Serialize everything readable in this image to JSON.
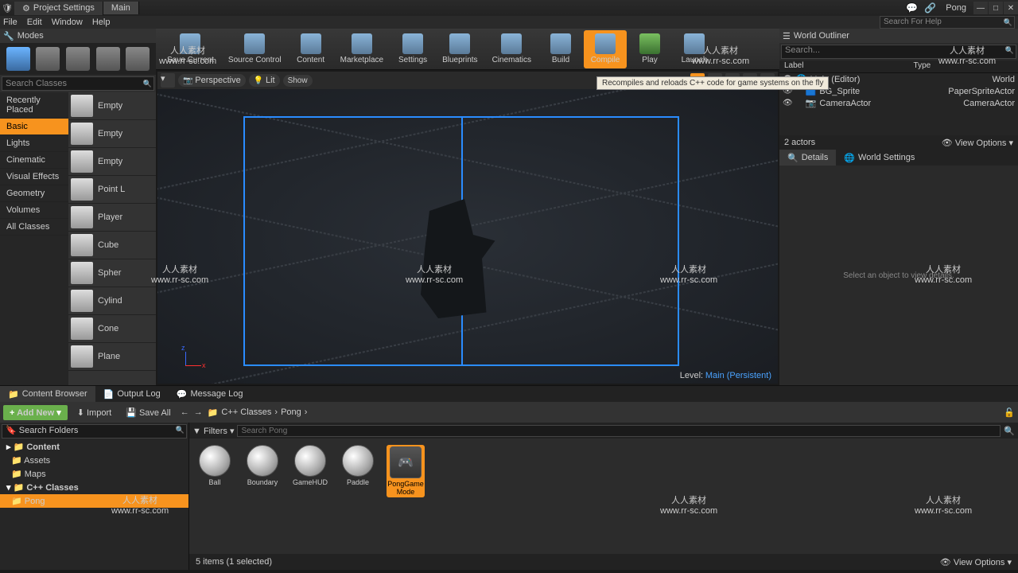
{
  "title": {
    "tab1": "Project Settings",
    "tab2": "Main",
    "project": "Pong"
  },
  "menu": [
    "File",
    "Edit",
    "Window",
    "Help"
  ],
  "search_help_placeholder": "Search For Help",
  "modes": {
    "header": "Modes",
    "search_placeholder": "Search Classes",
    "categories": [
      "Recently Placed",
      "Basic",
      "Lights",
      "Cinematic",
      "Visual Effects",
      "Geometry",
      "Volumes",
      "All Classes"
    ],
    "selected_category": "Basic",
    "items": [
      {
        "label": "Empty"
      },
      {
        "label": "Empty"
      },
      {
        "label": "Empty"
      },
      {
        "label": "Point L"
      },
      {
        "label": "Player"
      },
      {
        "label": "Cube"
      },
      {
        "label": "Spher"
      },
      {
        "label": "Cylind"
      },
      {
        "label": "Cone"
      },
      {
        "label": "Plane"
      }
    ]
  },
  "toolbar": [
    {
      "label": "Save Current"
    },
    {
      "label": "Source Control"
    },
    {
      "label": "Content"
    },
    {
      "label": "Marketplace"
    },
    {
      "label": "Settings"
    },
    {
      "label": "Blueprints"
    },
    {
      "label": "Cinematics"
    },
    {
      "label": "Build"
    },
    {
      "label": "Compile",
      "active": true
    },
    {
      "label": "Play"
    },
    {
      "label": "Launch"
    }
  ],
  "tooltip": "Recompiles and reloads C++ code for game systems on the fly",
  "viewport": {
    "perspective": "Perspective",
    "lit": "Lit",
    "show": "Show",
    "level_label": "Level:",
    "level_value": "Main (Persistent)"
  },
  "outliner": {
    "title": "World Outliner",
    "search_placeholder": "Search...",
    "col_label": "Label",
    "col_type": "Type",
    "rows": [
      {
        "label": "Main (Editor)",
        "type": "World"
      },
      {
        "label": "BG_Sprite",
        "type": "PaperSpriteActor"
      },
      {
        "label": "CameraActor",
        "type": "CameraActor"
      }
    ],
    "count": "2 actors",
    "viewopts": "View Options"
  },
  "details": {
    "tab1": "Details",
    "tab2": "World Settings",
    "empty": "Select an object to view details."
  },
  "bottom_tabs": [
    "Content Browser",
    "Output Log",
    "Message Log"
  ],
  "cb": {
    "add": "Add New",
    "import": "Import",
    "saveall": "Save All",
    "breadcrumb": [
      "C++ Classes",
      "Pong"
    ],
    "tree_search_placeholder": "Search Folders",
    "tree": [
      {
        "label": "Content",
        "bold": true
      },
      {
        "label": "Assets"
      },
      {
        "label": "Maps"
      },
      {
        "label": "C++ Classes",
        "bold": true
      },
      {
        "label": "Pong",
        "sel": true
      }
    ],
    "filters": "Filters",
    "asset_search_placeholder": "Search Pong",
    "assets": [
      {
        "label": "Ball"
      },
      {
        "label": "Boundary"
      },
      {
        "label": "GameHUD"
      },
      {
        "label": "Paddle"
      },
      {
        "label": "PongGame\nMode",
        "sel": true
      }
    ],
    "status": "5 items (1 selected)",
    "viewopts": "View Options"
  },
  "watermark": {
    "line1": "人人素材",
    "line2": "www.rr-sc.com"
  }
}
